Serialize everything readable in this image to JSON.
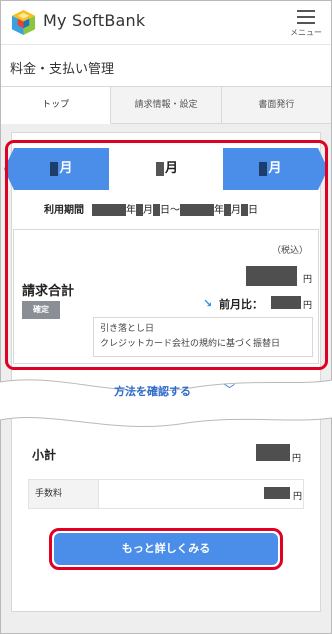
{
  "header": {
    "app_title": "My SoftBank",
    "menu_label": "メニュー",
    "logo_icon": "softbank-cube-logo",
    "menu_icon": "hamburger-menu-icon"
  },
  "page": {
    "title": "料金・支払い管理"
  },
  "tabs": [
    {
      "label": "トップ",
      "active": true
    },
    {
      "label": "請求情報・設定",
      "active": false
    },
    {
      "label": "書面発行",
      "active": false
    }
  ],
  "month_selector": {
    "prev_suffix": "月",
    "current_suffix": "月",
    "next_suffix": "月"
  },
  "period": {
    "label": "利用期間",
    "year_char": "年",
    "month_char": "月",
    "day_char": "日",
    "tilde": "～"
  },
  "billing": {
    "tax_label": "（税込）",
    "total_label": "請求合計",
    "status_badge": "確定",
    "yen": "円",
    "prev_ratio_label": "前月比：",
    "trend_icon": "arrow-down-right-icon",
    "withdrawal_line1": "引き落とし日",
    "withdrawal_line2": "クレジットカード会社の規約に基づく振替日"
  },
  "payment_link": {
    "label": "方法を確認する",
    "chevron": "﹀"
  },
  "breakdown": {
    "subtotal_label": "小計",
    "fee_label": "手数料",
    "yen": "円"
  },
  "actions": {
    "more_label": "もっと詳しくみる"
  },
  "colors": {
    "accent_blue": "#4a8eea",
    "highlight_red": "#e00023",
    "link_blue": "#2f6bc9",
    "badge_gray": "#8a8f95"
  }
}
